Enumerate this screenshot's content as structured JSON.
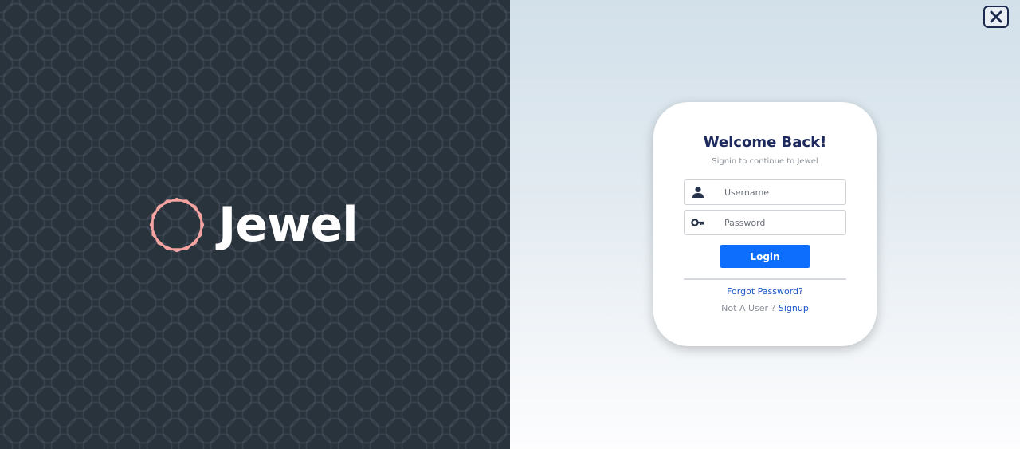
{
  "brand": {
    "name": "Jewel",
    "icon": "octagon-gem-icon",
    "icon_color": "#f4a3a0"
  },
  "close": {
    "icon": "close-icon"
  },
  "login": {
    "title": "Welcome Back!",
    "subtitle": "Signin to continue to Jewel",
    "username": {
      "icon": "user-icon",
      "placeholder": "Username",
      "value": ""
    },
    "password": {
      "icon": "key-icon",
      "placeholder": "Password",
      "value": ""
    },
    "login_label": "Login",
    "forgot_label": "Forgot Password?",
    "not_user_label": "Not A User ?",
    "signup_label": "Signup"
  },
  "colors": {
    "left_panel_bg": "#29333b",
    "accent": "#0d6efd",
    "title": "#1e2a5e",
    "link": "#1a55c9"
  }
}
